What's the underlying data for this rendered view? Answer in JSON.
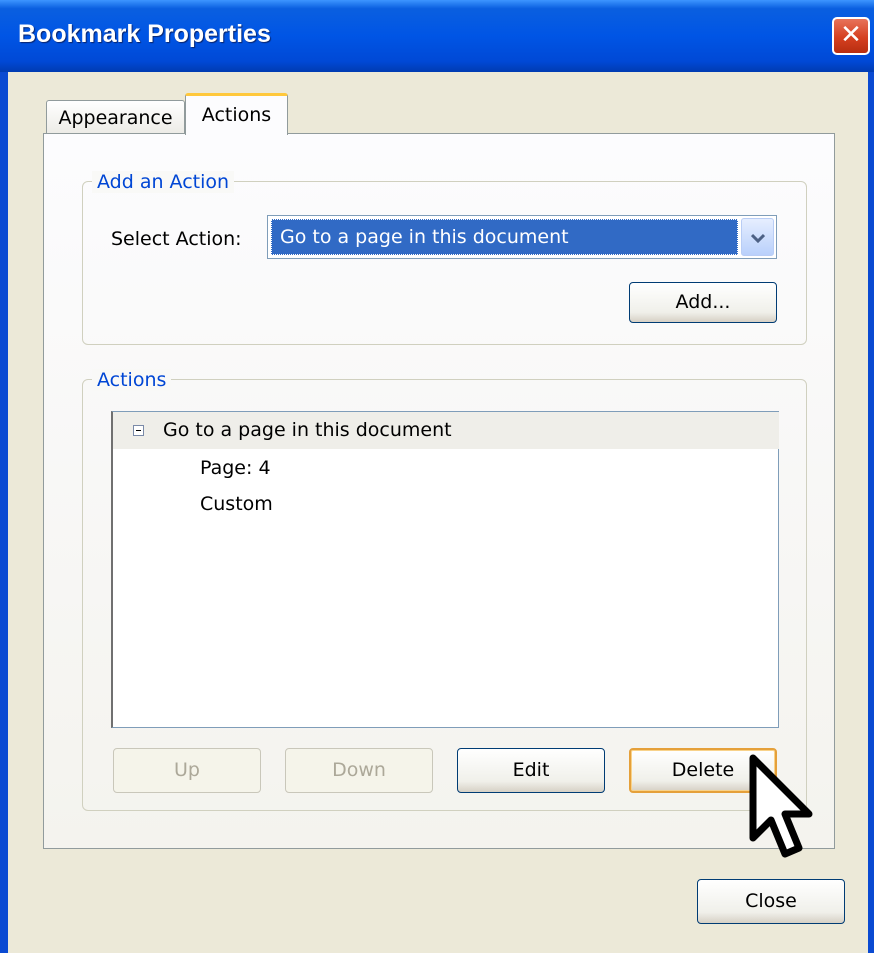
{
  "window": {
    "title": "Bookmark Properties",
    "close_glyph": "✕"
  },
  "tabs": [
    {
      "label": "Appearance",
      "selected": false
    },
    {
      "label": "Actions",
      "selected": true
    }
  ],
  "add_action": {
    "legend": "Add an Action",
    "select_label": "Select Action:",
    "selected_value": "Go to a page in this document",
    "add_button": "Add..."
  },
  "actions": {
    "legend": "Actions",
    "tree": {
      "root": "Go to a page in this document",
      "expanded": true,
      "children": [
        "Page: 4",
        "Custom"
      ]
    },
    "buttons": {
      "up": "Up",
      "down": "Down",
      "edit": "Edit",
      "delete": "Delete"
    }
  },
  "footer": {
    "close_button": "Close"
  },
  "colors": {
    "title_bar": "#0055e5",
    "selection": "#316ac5",
    "legend_text": "#0046d5",
    "focus_border": "#e5a03a"
  },
  "icons": {
    "close": "close-icon",
    "dropdown": "chevron-down-icon",
    "collapse": "collapse-icon",
    "cursor": "mouse-pointer-icon"
  }
}
